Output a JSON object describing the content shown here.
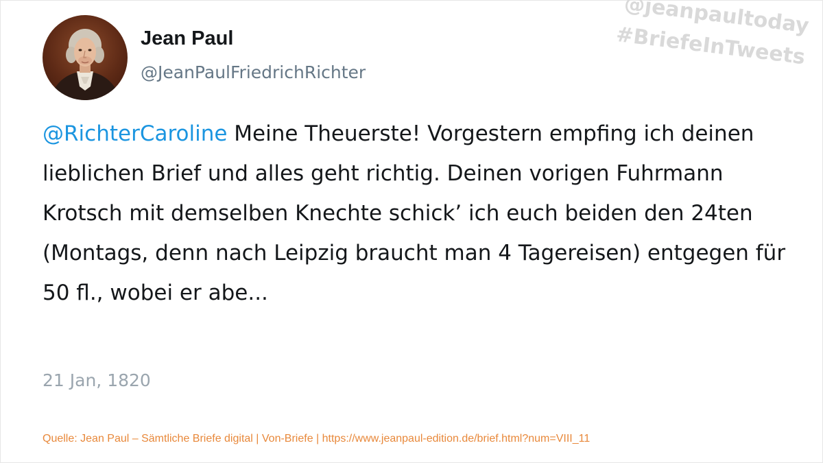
{
  "profile": {
    "display_name": "Jean Paul",
    "handle": "@JeanPaulFriedrichRichter",
    "avatar_icon": "portrait-avatar"
  },
  "watermark": {
    "line1": "@jeanpaultoday",
    "line2": "#BriefeInTweets"
  },
  "tweet": {
    "mention": "@RichterCaroline",
    "body": " Meine Theuerste! Vorgestern empfing ich deinen lieblichen Brief und alles geht richtig. Deinen vorigen Fuhrmann Krotsch mit demselben Knechte schick’ ich euch beiden den 24ten (Montags, denn nach Leipzig braucht man 4 Tagereisen) entgegen für 50 fl., wobei er abe...",
    "date": "21 Jan, 1820"
  },
  "footer": {
    "source": "Quelle: Jean Paul – Sämtliche Briefe digital | Von-Briefe | https://www.jeanpaul-edition.de/brief.html?num=VIII_11"
  },
  "colors": {
    "mention": "#1b95e0",
    "text": "#14171a",
    "muted": "#657786",
    "source": "#e8883a",
    "watermark": "#d9d9d9"
  }
}
